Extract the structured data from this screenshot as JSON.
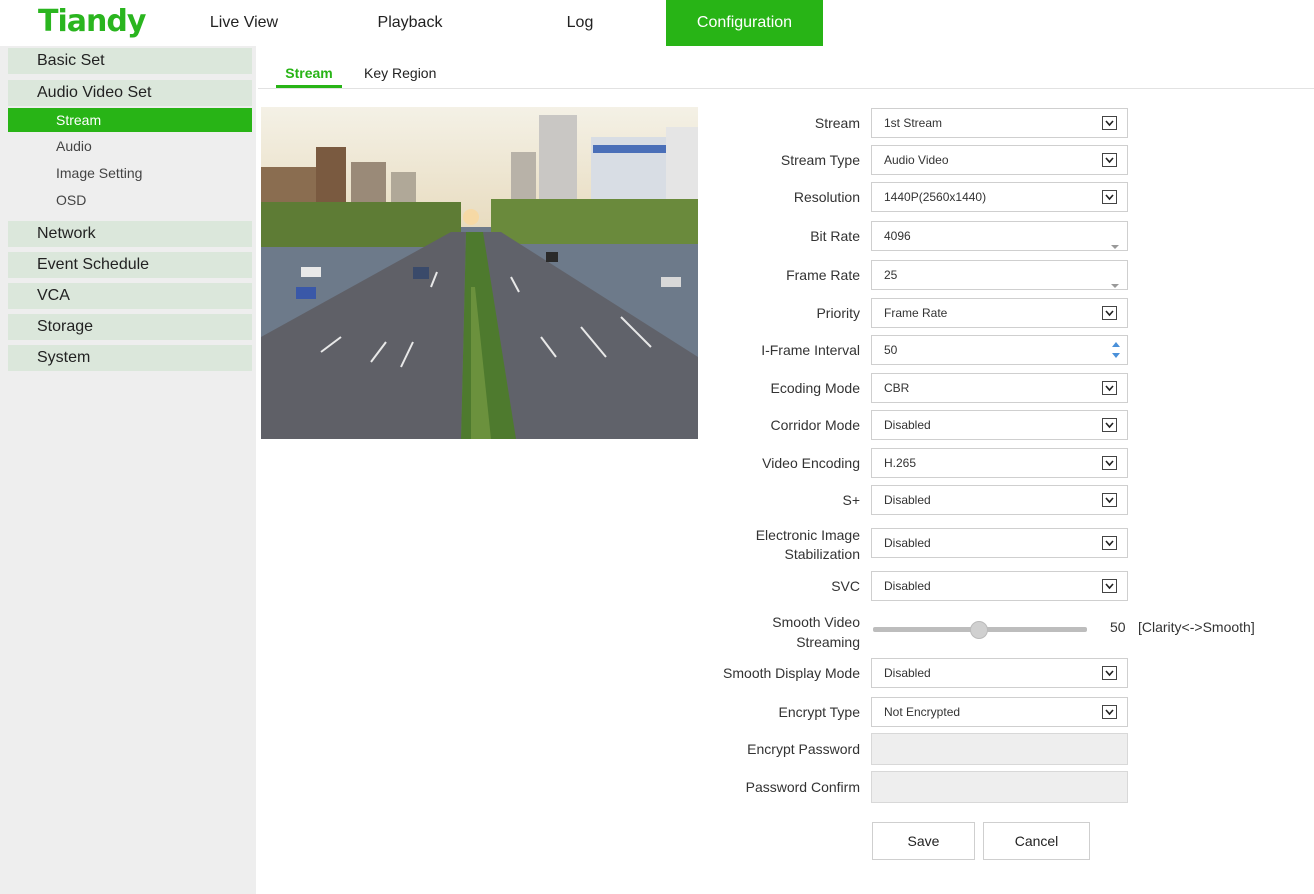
{
  "brand": {
    "logo": "Tiandy",
    "accent": "#28b416"
  },
  "nav": {
    "live_view": "Live View",
    "playback": "Playback",
    "log": "Log",
    "configuration": "Configuration"
  },
  "sidebar": {
    "basic_set": "Basic Set",
    "audio_video_set": "Audio Video Set",
    "stream": "Stream",
    "audio": "Audio",
    "image_setting": "Image Setting",
    "osd": "OSD",
    "network": "Network",
    "event_schedule": "Event Schedule",
    "vca": "VCA",
    "storage": "Storage",
    "system": "System",
    "selected": "Stream"
  },
  "tabs": {
    "stream": "Stream",
    "key_region": "Key Region",
    "active": "Stream"
  },
  "form": {
    "stream": {
      "label": "Stream",
      "value": "1st Stream"
    },
    "stream_type": {
      "label": "Stream Type",
      "value": "Audio Video"
    },
    "resolution": {
      "label": "Resolution",
      "value": "1440P(2560x1440)"
    },
    "bit_rate": {
      "label": "Bit Rate",
      "value": "4096"
    },
    "frame_rate": {
      "label": "Frame Rate",
      "value": "25"
    },
    "priority": {
      "label": "Priority",
      "value": "Frame Rate"
    },
    "i_frame_interval": {
      "label": "I-Frame Interval",
      "value": "50"
    },
    "encoding_mode": {
      "label": "Ecoding Mode",
      "value": "CBR"
    },
    "corridor_mode": {
      "label": "Corridor Mode",
      "value": "Disabled"
    },
    "video_encoding": {
      "label": "Video Encoding",
      "value": "H.265"
    },
    "s_plus": {
      "label": "S+",
      "value": "Disabled"
    },
    "eis": {
      "label_line1": "Electronic Image",
      "label_line2": "Stabilization",
      "value": "Disabled"
    },
    "svc": {
      "label": "SVC",
      "value": "Disabled"
    },
    "smooth_streaming": {
      "label_line1": "Smooth Video",
      "label_line2": "Streaming",
      "value": "50",
      "hint": "[Clarity<->Smooth]",
      "level": 0.5
    },
    "smooth_display_mode": {
      "label": "Smooth Display Mode",
      "value": "Disabled"
    },
    "encrypt_type": {
      "label": "Encrypt Type",
      "value": "Not Encrypted"
    },
    "encrypt_password": {
      "label": "Encrypt Password",
      "value": ""
    },
    "password_confirm": {
      "label": "Password Confirm",
      "value": ""
    }
  },
  "buttons": {
    "save": "Save",
    "cancel": "Cancel"
  },
  "icons": {
    "select_arrow": "chevron-down-icon",
    "combo_arrow": "caret-down-icon",
    "spinner": "spinner-arrows-icon"
  }
}
